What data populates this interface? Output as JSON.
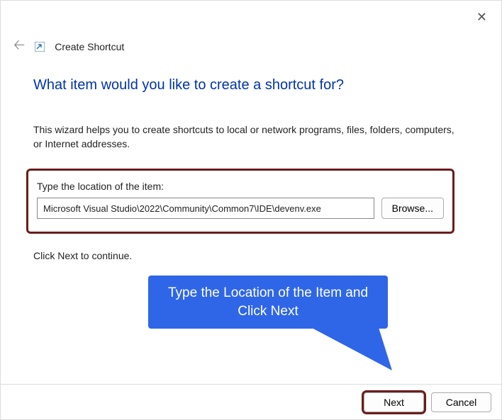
{
  "window": {
    "title": "Create Shortcut"
  },
  "heading": "What item would you like to create a shortcut for?",
  "description": "This wizard helps you to create shortcuts to local or network programs, files, folders, computers, or Internet addresses.",
  "input": {
    "label": "Type the location of the item:",
    "value": "Microsoft Visual Studio\\2022\\Community\\Common7\\IDE\\devenv.exe",
    "browse_label": "Browse..."
  },
  "continue_text": "Click Next to continue.",
  "callout": "Type the Location of the Item and Click Next",
  "footer": {
    "next_label": "Next",
    "cancel_label": "Cancel"
  },
  "colors": {
    "highlight": "#6b1d1d",
    "heading": "#0033aa",
    "callout_bg": "#2f66e8"
  }
}
